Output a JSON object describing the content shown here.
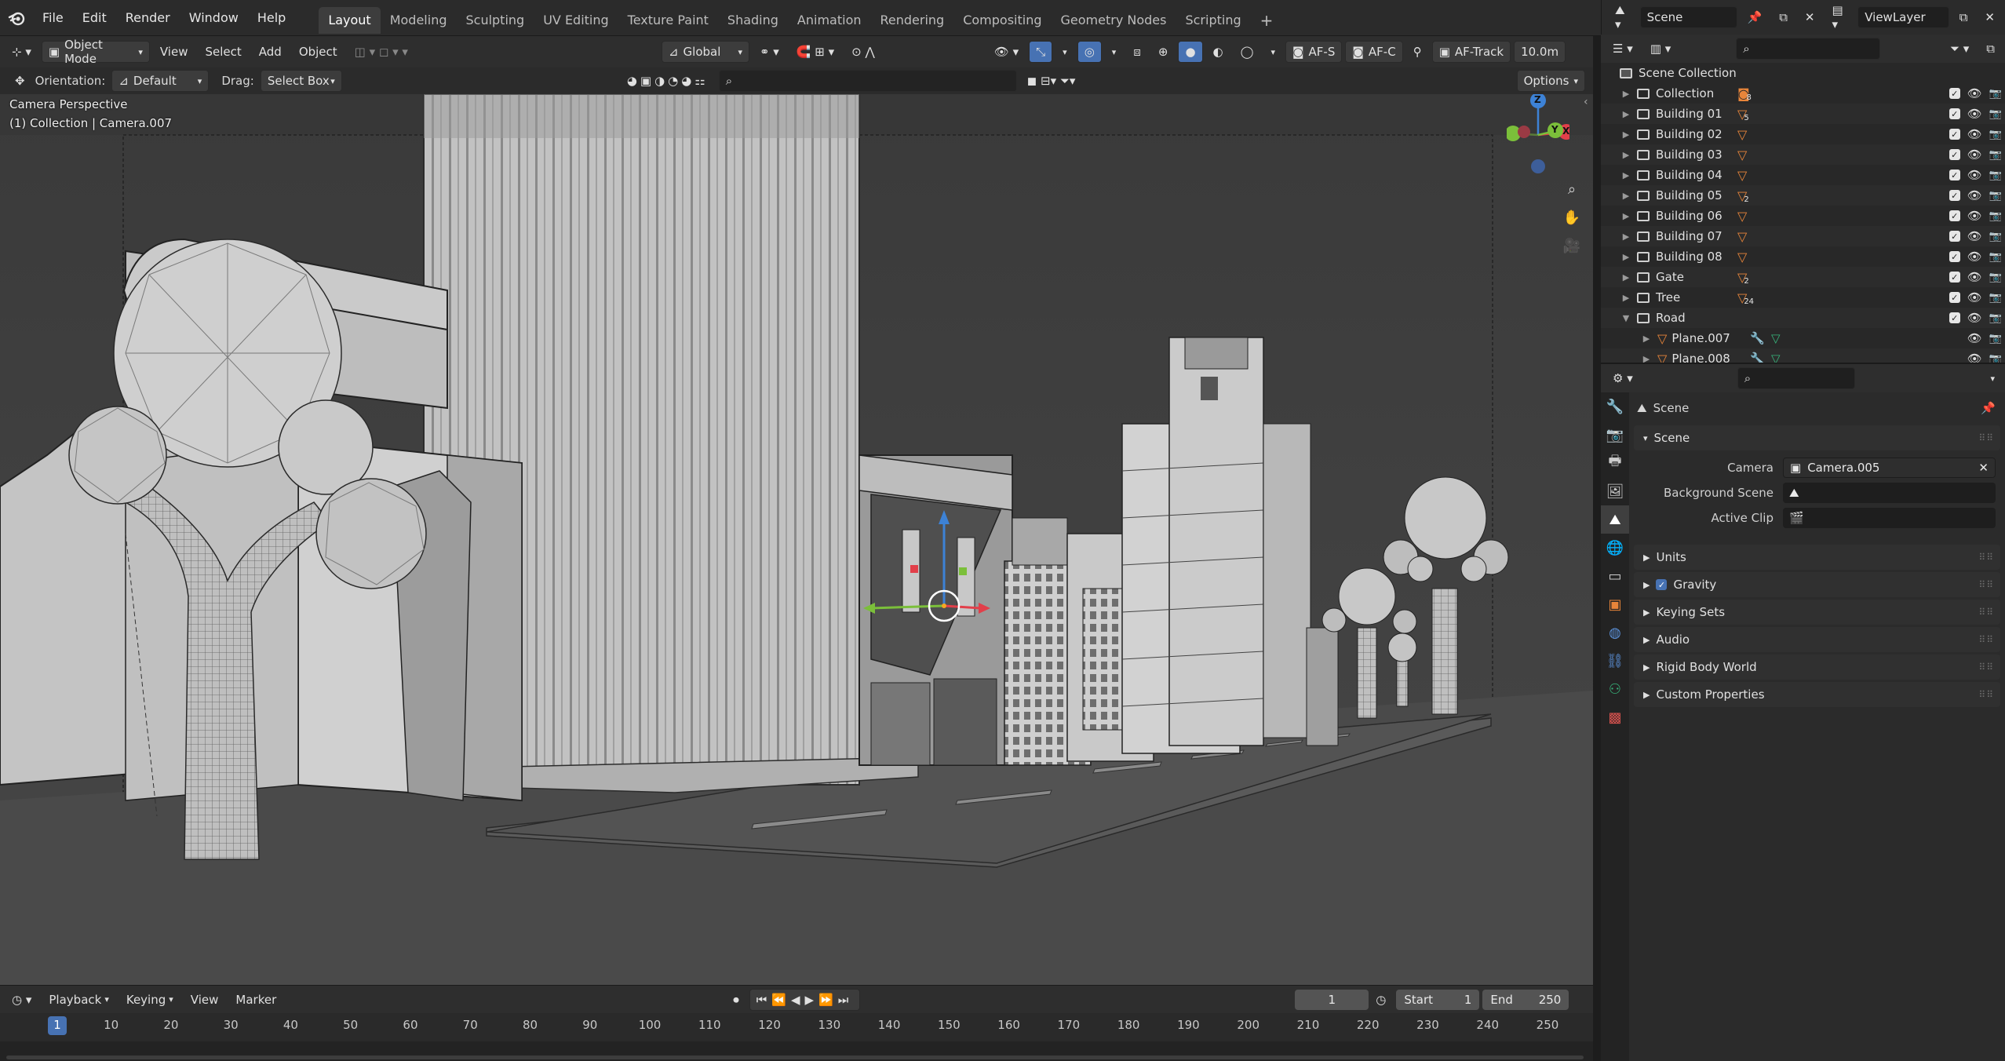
{
  "topbar": {
    "menus": [
      "File",
      "Edit",
      "Render",
      "Window",
      "Help"
    ],
    "workspaces": [
      "Layout",
      "Modeling",
      "Sculpting",
      "UV Editing",
      "Texture Paint",
      "Shading",
      "Animation",
      "Rendering",
      "Compositing",
      "Geometry Nodes",
      "Scripting"
    ],
    "add_tab": "+",
    "scene_label": "Scene",
    "view_layer_label": "ViewLayer"
  },
  "viewport_header": {
    "mode": "Object Mode",
    "menus": [
      "View",
      "Select",
      "Add",
      "Object"
    ],
    "transform_orientation": "Global",
    "af_s": "AF-S",
    "af_c": "AF-C",
    "af_track": "AF-Track",
    "distance": "10.0m",
    "orientation_label": "Orientation:",
    "orientation_value": "Default",
    "drag_label": "Drag:",
    "drag_value": "Select Box",
    "options": "Options"
  },
  "viewport": {
    "perspective_label": "Camera Perspective",
    "collection_label": "(1) Collection | Camera.007",
    "gizmo": {
      "x": "X",
      "y": "Y",
      "z": "Z"
    }
  },
  "timeline": {
    "menus": [
      "Playback",
      "Keying",
      "View",
      "Marker"
    ],
    "current_frame": "1",
    "start_label": "Start",
    "start_value": "1",
    "end_label": "End",
    "end_value": "250",
    "ruler_ticks": [
      "1",
      "10",
      "20",
      "30",
      "40",
      "50",
      "60",
      "70",
      "80",
      "90",
      "100",
      "110",
      "120",
      "130",
      "140",
      "150",
      "160",
      "170",
      "180",
      "190",
      "200",
      "210",
      "220",
      "230",
      "240",
      "250"
    ]
  },
  "outliner": {
    "root": "Scene Collection",
    "rows": [
      {
        "name": "Collection",
        "badge": "8",
        "kind": "collection"
      },
      {
        "name": "Building 01",
        "badge": "5",
        "kind": "collection"
      },
      {
        "name": "Building 02",
        "badge": "",
        "kind": "collection"
      },
      {
        "name": "Building 03",
        "badge": "",
        "kind": "collection"
      },
      {
        "name": "Building 04",
        "badge": "",
        "kind": "collection"
      },
      {
        "name": "Building 05",
        "badge": "2",
        "kind": "collection"
      },
      {
        "name": "Building 06",
        "badge": "",
        "kind": "collection"
      },
      {
        "name": "Building 07",
        "badge": "",
        "kind": "collection"
      },
      {
        "name": "Building 08",
        "badge": "",
        "kind": "collection"
      },
      {
        "name": "Gate",
        "badge": "2",
        "kind": "collection"
      },
      {
        "name": "Tree",
        "badge": "24",
        "kind": "collection"
      },
      {
        "name": "Road",
        "badge": "",
        "kind": "collection-open"
      },
      {
        "name": "Plane.007",
        "badge": "",
        "kind": "object"
      },
      {
        "name": "Plane.008",
        "badge": "",
        "kind": "object"
      }
    ]
  },
  "properties": {
    "context_title": "Scene",
    "scene_panel_title": "Scene",
    "camera_label": "Camera",
    "camera_value": "Camera.005",
    "background_scene_label": "Background Scene",
    "active_clip_label": "Active Clip",
    "panels": [
      "Units",
      "Gravity",
      "Keying Sets",
      "Audio",
      "Rigid Body World",
      "Custom Properties"
    ]
  },
  "colors": {
    "accent_blue": "#4772b3",
    "orange_object": "#e8853a",
    "gizmo_x": "#e23f4a",
    "gizmo_y": "#7bbf3a",
    "gizmo_z": "#3d82d6"
  }
}
